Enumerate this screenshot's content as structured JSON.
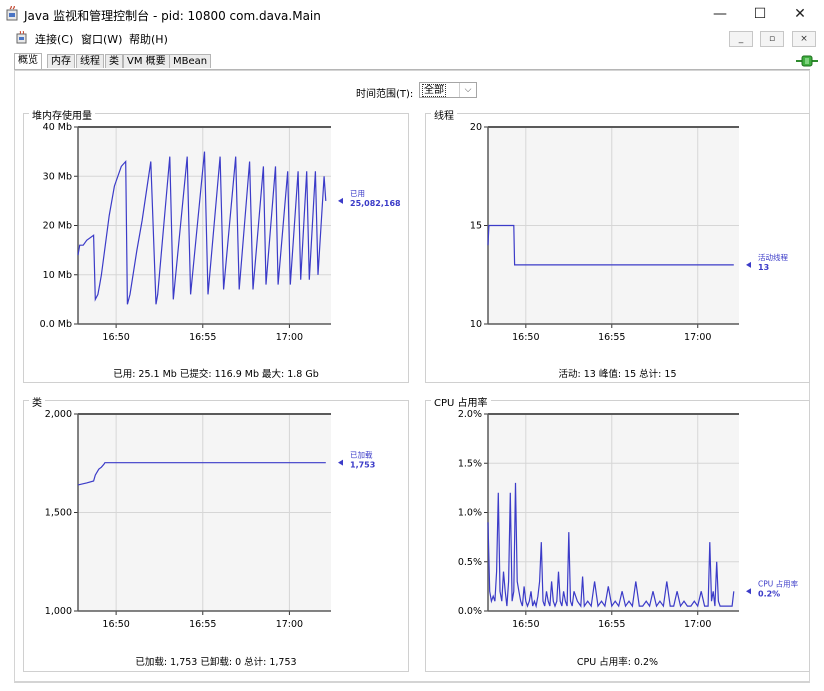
{
  "window": {
    "title": "Java 监视和管理控制台 - pid: 10800 com.dava.Main",
    "minimize_glyph": "—",
    "maximize_glyph": "☐",
    "close_glyph": "✕"
  },
  "menubar": {
    "items": [
      "连接(C)",
      "窗口(W)",
      "帮助(H)"
    ],
    "mdi_buttons": [
      "_",
      "▫",
      "×"
    ]
  },
  "tabs": [
    "概览",
    "内存",
    "线程",
    "类",
    "VM 概要",
    "MBean"
  ],
  "active_tab": 0,
  "time_range": {
    "label": "时间范围(T):",
    "value": "全部"
  },
  "colors": {
    "series": "#3b3bc8",
    "grid": "#d6d6d6",
    "plot_bg": "#f5f5f5",
    "frame": "#5a5a5a"
  },
  "panels": {
    "heap": {
      "title": "堆内存使用量",
      "legend_label": "已用",
      "legend_value": "25,082,168",
      "footer": "已用: 25.1 Mb    已提交: 116.9 Mb    最大: 1.8 Gb"
    },
    "threads": {
      "title": "线程",
      "legend_label": "活动线程",
      "legend_value": "13",
      "footer": "活动: 13    峰值: 15    总计: 15"
    },
    "classes": {
      "title": "类",
      "legend_label": "已加载",
      "legend_value": "1,753",
      "footer": "已加载: 1,753    已卸载: 0    总计: 1,753"
    },
    "cpu": {
      "title": "CPU 占用率",
      "legend_label": "CPU 占用率",
      "legend_value": "0.2%",
      "footer": "CPU 占用率: 0.2%"
    }
  },
  "chart_data": [
    {
      "type": "line",
      "title": "堆内存使用量",
      "x_tick_labels": [
        "16:50",
        "16:55",
        "17:00"
      ],
      "y_tick_labels": [
        "40 Mb",
        "30 Mb",
        "20 Mb",
        "10 Mb",
        "0.0 Mb"
      ],
      "ylim": [
        0,
        40
      ],
      "x_minutes": [
        0,
        0.1,
        0.3,
        0.5,
        0.9,
        1.0,
        1.15,
        1.25,
        1.35,
        1.8,
        2.1,
        2.5,
        2.75,
        2.85,
        3.0,
        3.4,
        3.7,
        4.2,
        4.5,
        4.6,
        5.3,
        5.5,
        6.3,
        6.5,
        7.3,
        7.5,
        8.2,
        8.4,
        9.1,
        9.3,
        9.9,
        10.1,
        10.7,
        10.85,
        11.4,
        11.55,
        12.1,
        12.25,
        12.7,
        12.85,
        13.2,
        13.35,
        13.7,
        13.85,
        14.2,
        14.3
      ],
      "series": [
        {
          "name": "已用",
          "y_mb": [
            14,
            16,
            16,
            17,
            18,
            5,
            6,
            8,
            10,
            22,
            28,
            32,
            33,
            4,
            6,
            15,
            21,
            33,
            4,
            6,
            34,
            5,
            34,
            6,
            35,
            6,
            34,
            7,
            34,
            7,
            33,
            7,
            32,
            8,
            32,
            8,
            31,
            8,
            31,
            9,
            31,
            9,
            31,
            10,
            30,
            25
          ]
        }
      ]
    },
    {
      "type": "line",
      "title": "线程",
      "x_tick_labels": [
        "16:50",
        "16:55",
        "17:00"
      ],
      "y_tick_labels": [
        "20",
        "15",
        "10"
      ],
      "ylim": [
        10,
        20
      ],
      "x_minutes": [
        0,
        0.05,
        1.5,
        1.55,
        14.3
      ],
      "series": [
        {
          "name": "活动线程",
          "values": [
            14,
            15,
            15,
            13,
            13
          ]
        }
      ]
    },
    {
      "type": "line",
      "title": "类",
      "x_tick_labels": [
        "16:50",
        "16:55",
        "17:00"
      ],
      "y_tick_labels": [
        "2,000",
        "1,500",
        "1,000"
      ],
      "ylim": [
        1000,
        2000
      ],
      "x_minutes": [
        0,
        0.5,
        0.9,
        1.0,
        1.2,
        1.35,
        1.5,
        1.55,
        14.3
      ],
      "series": [
        {
          "name": "已加载",
          "values": [
            1640,
            1650,
            1660,
            1690,
            1720,
            1730,
            1745,
            1753,
            1753
          ]
        }
      ]
    },
    {
      "type": "line",
      "title": "CPU 占用率",
      "x_tick_labels": [
        "16:50",
        "16:55",
        "17:00"
      ],
      "y_tick_labels": [
        "2.0%",
        "1.5%",
        "1.0%",
        "0.5%",
        "0.0%"
      ],
      "ylim": [
        0,
        2.0
      ],
      "x_minutes": [
        0,
        0.1,
        0.2,
        0.3,
        0.4,
        0.5,
        0.6,
        0.7,
        0.8,
        0.9,
        1.0,
        1.1,
        1.2,
        1.3,
        1.4,
        1.5,
        1.6,
        1.7,
        1.8,
        1.9,
        2.0,
        2.1,
        2.2,
        2.3,
        2.4,
        2.5,
        2.6,
        2.7,
        2.8,
        2.9,
        3.0,
        3.1,
        3.2,
        3.3,
        3.4,
        3.5,
        3.6,
        3.7,
        3.8,
        3.9,
        4.0,
        4.1,
        4.2,
        4.3,
        4.4,
        4.5,
        4.6,
        4.7,
        4.8,
        4.9,
        5.0,
        5.2,
        5.4,
        5.5,
        5.6,
        5.8,
        6.0,
        6.2,
        6.4,
        6.6,
        6.8,
        7.0,
        7.2,
        7.4,
        7.6,
        7.8,
        8.0,
        8.2,
        8.4,
        8.6,
        8.8,
        9.0,
        9.2,
        9.4,
        9.6,
        9.8,
        10.0,
        10.2,
        10.4,
        10.6,
        10.8,
        11.0,
        11.2,
        11.4,
        11.6,
        11.8,
        12.0,
        12.2,
        12.4,
        12.6,
        12.8,
        12.9,
        13.0,
        13.1,
        13.2,
        13.3,
        13.4,
        13.5,
        13.6,
        13.7,
        13.8,
        13.9,
        14.0,
        14.1,
        14.2,
        14.3
      ],
      "series": [
        {
          "name": "CPU 占用率",
          "values": [
            0.9,
            0.2,
            0.1,
            0.15,
            0.1,
            0.4,
            1.2,
            0.2,
            0.1,
            0.4,
            0.2,
            0.05,
            0.3,
            1.2,
            0.1,
            0.2,
            1.3,
            0.3,
            0.2,
            0.1,
            0.05,
            0.25,
            0.1,
            0.05,
            0.1,
            0.2,
            0.05,
            0.1,
            0.05,
            0.15,
            0.3,
            0.7,
            0.1,
            0.05,
            0.2,
            0.1,
            0.05,
            0.3,
            0.1,
            0.05,
            0.1,
            0.4,
            0.1,
            0.05,
            0.2,
            0.1,
            0.05,
            0.8,
            0.1,
            0.05,
            0.2,
            0.1,
            0.05,
            0.35,
            0.05,
            0.1,
            0.05,
            0.3,
            0.05,
            0.1,
            0.05,
            0.25,
            0.05,
            0.1,
            0.05,
            0.2,
            0.05,
            0.1,
            0.05,
            0.3,
            0.05,
            0.05,
            0.1,
            0.05,
            0.2,
            0.05,
            0.1,
            0.05,
            0.3,
            0.05,
            0.05,
            0.2,
            0.05,
            0.1,
            0.05,
            0.05,
            0.1,
            0.05,
            0.2,
            0.05,
            0.05,
            0.7,
            0.1,
            0.2,
            0.05,
            0.5,
            0.1,
            0.05,
            0.05,
            0.05,
            0.05,
            0.05,
            0.05,
            0.05,
            0.05,
            0.2
          ]
        }
      ]
    }
  ]
}
